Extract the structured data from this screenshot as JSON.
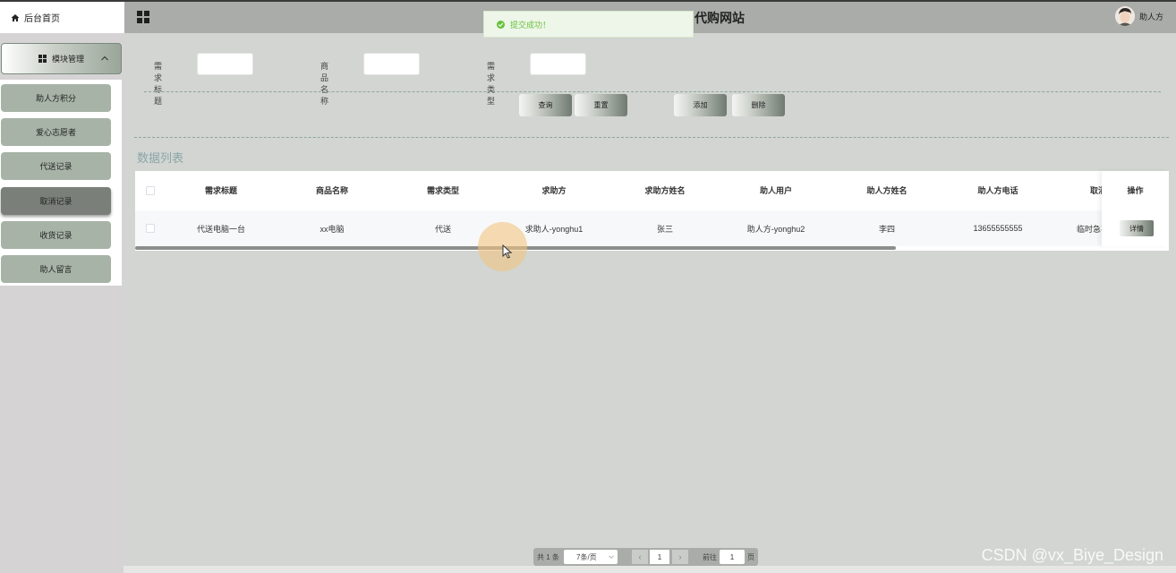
{
  "header": {
    "home_label": "后台首页",
    "site_title": "代购网站",
    "user_name": "助人方"
  },
  "toast": {
    "message": "提交成功！"
  },
  "sidebar": {
    "group_label": "模块管理",
    "items": [
      {
        "label": "助人方积分"
      },
      {
        "label": "爱心志愿者"
      },
      {
        "label": "代送记录"
      },
      {
        "label": "取消记录",
        "active": true
      },
      {
        "label": "收货记录"
      },
      {
        "label": "助人留言"
      }
    ]
  },
  "search": {
    "fields": [
      {
        "label": "需求标题",
        "value": ""
      },
      {
        "label": "商品名称",
        "value": ""
      },
      {
        "label": "需求类型",
        "value": ""
      }
    ],
    "buttons": {
      "query": "查询",
      "reset": "重置",
      "add": "添加",
      "delete": "删除"
    }
  },
  "list": {
    "title": "数据列表",
    "columns": [
      "需求标题",
      "商品名称",
      "需求类型",
      "求助方",
      "求助方姓名",
      "助人用户",
      "助人方姓名",
      "助人方电话",
      "取消"
    ],
    "rows": [
      [
        "代送电脑一台",
        "xx电脑",
        "代送",
        "求助人-yonghu1",
        "张三",
        "助人方-yonghu2",
        "李四",
        "13655555555",
        "临时急事"
      ]
    ],
    "op_header": "操作",
    "detail_label": "详情"
  },
  "pagination": {
    "total": "共 1 条",
    "page_size": "7条/页",
    "prev": "‹",
    "next": "›",
    "current": "1",
    "goto_label": "前往",
    "goto_value": "1",
    "page_suffix": "页"
  },
  "watermark": "CSDN @vx_Biye_Design",
  "colors": {
    "accent": "#a7b3a7",
    "toast_green": "#67c23a",
    "list_title": "#8aa6a8"
  }
}
